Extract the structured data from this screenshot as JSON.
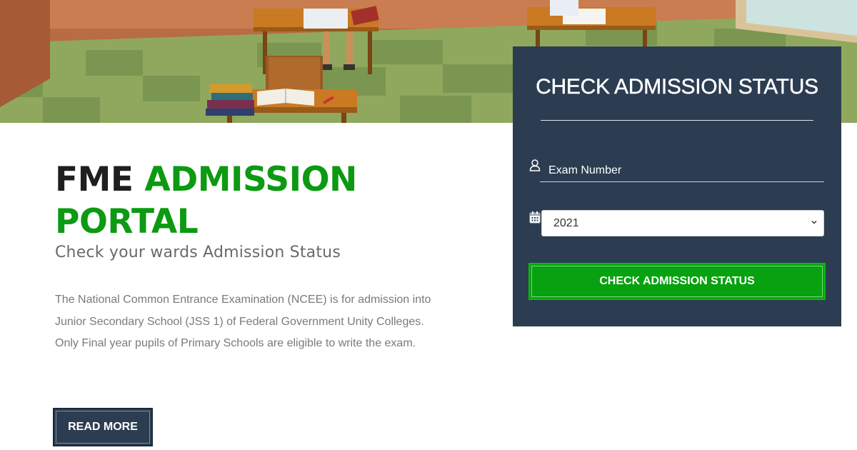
{
  "hero": {
    "image_name": "classroom-illustration"
  },
  "main": {
    "title_part1": "FME",
    "title_part2": "ADMISSION",
    "title_part3": "PORTAL",
    "subtitle": "Check your wards Admission Status",
    "description": "The National Common Entrance Examination (NCEE) is for admission into Junior Secondary School (JSS 1) of Federal Government Unity Colleges. Only Final year pupils of Primary Schools are eligible to write the exam.",
    "read_more_label": "READ MORE"
  },
  "admission_form": {
    "heading": "CHECK ADMISSION STATUS",
    "exam_number": {
      "placeholder": "Exam Number",
      "value": "",
      "icon": "user-icon"
    },
    "year": {
      "selected": "2021",
      "icon": "calendar-icon"
    },
    "submit_label": "CHECK ADMISSION STATUS"
  },
  "colors": {
    "panel_bg": "#2c3d52",
    "accent_green": "#08a10f",
    "title_green": "#0c9a12",
    "title_dark": "#1f1f1f",
    "text_gray": "#7a7a7a"
  }
}
